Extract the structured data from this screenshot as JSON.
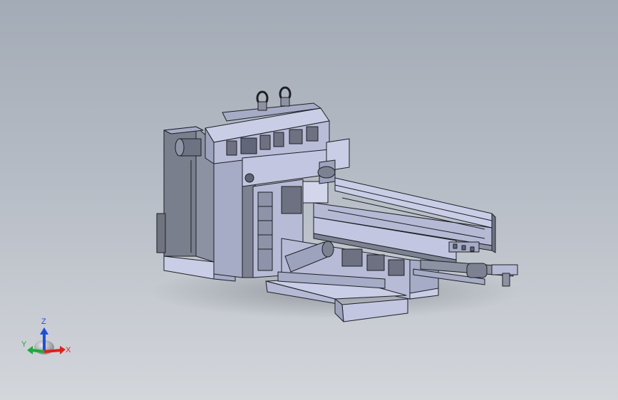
{
  "viewport": {
    "background_top": "#a3abb6",
    "background_bottom": "#d3d6db",
    "model_colors": {
      "face_light": "#c9cde6",
      "face_mid": "#a6abc6",
      "face_dark": "#7a7f8e",
      "edge": "#1e2024"
    }
  },
  "triad": {
    "x_label": "X",
    "y_label": "Y",
    "z_label": "Z",
    "x_color": "#e0201c",
    "y_color": "#1fa83a",
    "z_color": "#1f4fd8"
  }
}
